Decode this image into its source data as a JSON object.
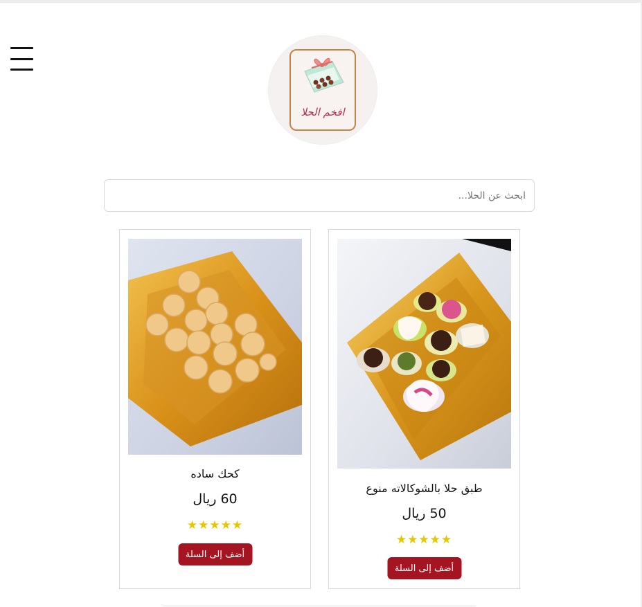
{
  "header": {
    "menu_icon": "hamburger-menu-icon",
    "logo_text": "افخم الحلا"
  },
  "search": {
    "placeholder": "ابحث عن الحلا...",
    "value": "",
    "icon": "none"
  },
  "products": [
    {
      "name": "طبق حلا بالشوكالاته منوع",
      "price": "50 ريال",
      "stars": "★★★★★",
      "rating": 5,
      "button_label": "أضف إلى السلة",
      "image": "chocolate-assortment-tray-photo"
    },
    {
      "name": "كحك ساده",
      "price": "60 ريال",
      "stars": "★★★★★",
      "rating": 5,
      "button_label": "أضف إلى السلة",
      "image": "plain-kaak-cookies-tray-photo"
    }
  ],
  "colors": {
    "button_bg": "#a51421",
    "star": "#e3c800",
    "logo_text": "#b52e4e",
    "logo_border": "#c5843f"
  }
}
